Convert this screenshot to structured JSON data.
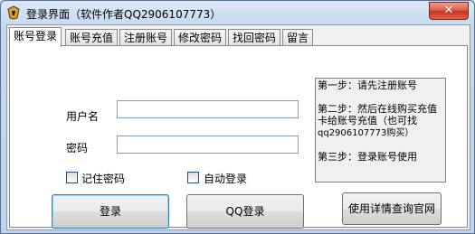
{
  "window": {
    "title": "登录界面（软件作者QQ2906107773）",
    "close_label": "✕"
  },
  "tabs": [
    {
      "label": "账号登录"
    },
    {
      "label": "账号充值"
    },
    {
      "label": "注册账号"
    },
    {
      "label": "修改密码"
    },
    {
      "label": "找回密码"
    },
    {
      "label": "留言"
    }
  ],
  "form": {
    "username_label": "用户名",
    "username_value": "",
    "password_label": "密码",
    "password_value": "",
    "remember_label": "记住密码",
    "auto_login_label": "自动登录"
  },
  "buttons": {
    "login": "登录",
    "qq_login": "QQ登录",
    "docs": "使用详情查询官网"
  },
  "notes": {
    "step1": "第一步：请先注册账号",
    "step2a": "第二步：然后在线购买充值卡给账号充值（也可找",
    "step2b": "qq2906107773购买）",
    "step3": "第三步：登录账号使用"
  },
  "colors": {
    "frame": "#c9daf0",
    "close": "#c4321c"
  }
}
